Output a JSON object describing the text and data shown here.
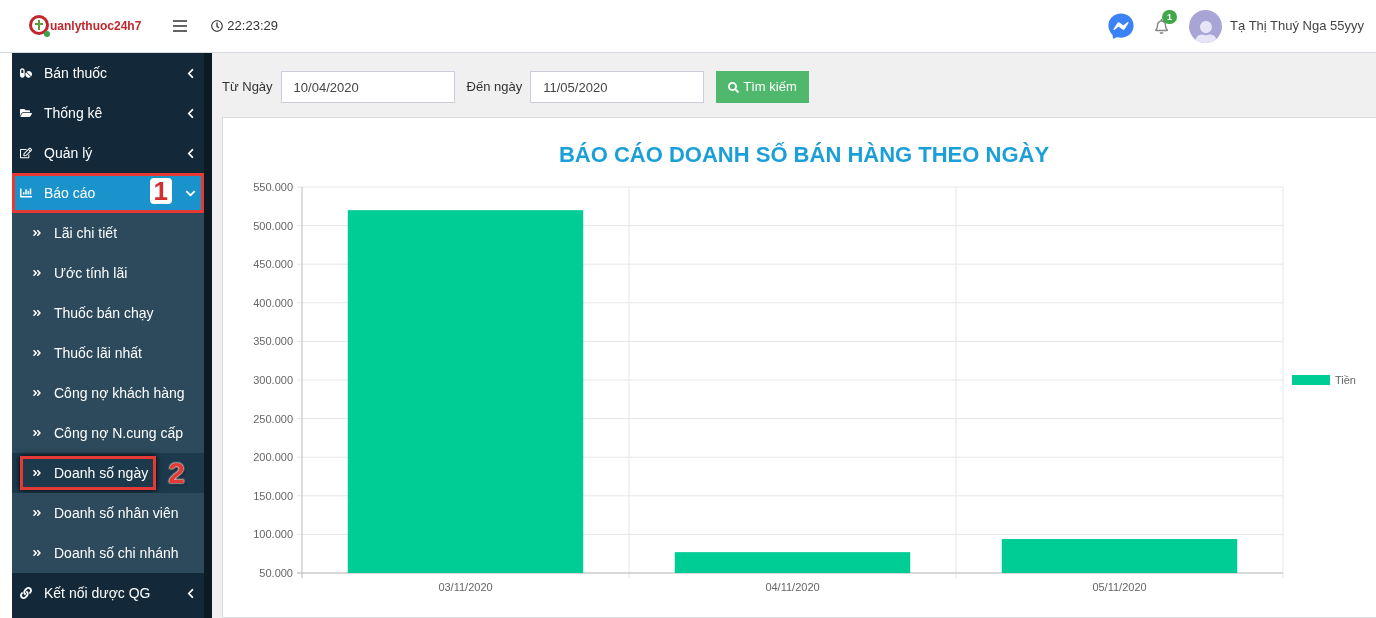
{
  "header": {
    "logo_text": "uanlythuoc24h7",
    "clock": "22:23:29",
    "notifications": "1",
    "user_name": "Tạ Thị Thuý Nga 55yyy"
  },
  "sidebar": {
    "items": [
      {
        "label": "Bán thuốc",
        "expanded": false,
        "highlighted": false
      },
      {
        "label": "Thống kê",
        "expanded": false,
        "highlighted": false
      },
      {
        "label": "Quản lý",
        "expanded": false,
        "highlighted": false
      },
      {
        "label": "Báo cáo",
        "expanded": true,
        "highlighted": true,
        "callout": "1",
        "children": [
          {
            "label": "Lãi chi tiết",
            "selected": false,
            "highlighted": false
          },
          {
            "label": "Ước tính lãi",
            "selected": false,
            "highlighted": false
          },
          {
            "label": "Thuốc bán chạy",
            "selected": false,
            "highlighted": false
          },
          {
            "label": "Thuốc lãi nhất",
            "selected": false,
            "highlighted": false
          },
          {
            "label": "Công nợ khách hàng",
            "selected": false,
            "highlighted": false
          },
          {
            "label": "Công nợ N.cung cấp",
            "selected": false,
            "highlighted": false
          },
          {
            "label": "Doanh số ngày",
            "selected": true,
            "highlighted": true,
            "callout": "2"
          },
          {
            "label": "Doanh số nhân viên",
            "selected": false,
            "highlighted": false
          },
          {
            "label": "Doanh số chi nhánh",
            "selected": false,
            "highlighted": false
          }
        ]
      },
      {
        "label": "Kết nối dược QG",
        "expanded": false,
        "highlighted": false
      }
    ]
  },
  "filter": {
    "from_label": "Từ Ngày",
    "from_value": "10/04/2020",
    "to_label": "Đến ngày",
    "to_value": "11/05/2020",
    "search_button": "Tìm kiếm"
  },
  "report": {
    "chart_data": {
      "type": "bar",
      "title": "BÁO CÁO DOANH SỐ BÁN HÀNG THEO NGÀY",
      "categories": [
        "03/11/2020",
        "04/11/2020",
        "05/11/2020"
      ],
      "series": [
        {
          "name": "Tiền",
          "color": "#00cc96",
          "values": [
            520000,
            77000,
            94000
          ]
        }
      ],
      "ylim": [
        50000,
        550000
      ],
      "grid": true,
      "yticks": [
        {
          "value": 50000,
          "label": "50.000"
        },
        {
          "value": 100000,
          "label": "100.000"
        },
        {
          "value": 150000,
          "label": "150.000"
        },
        {
          "value": 200000,
          "label": "200.000"
        },
        {
          "value": 250000,
          "label": "250.000"
        },
        {
          "value": 300000,
          "label": "300.000"
        },
        {
          "value": 350000,
          "label": "350.000"
        },
        {
          "value": 400000,
          "label": "400.000"
        },
        {
          "value": 450000,
          "label": "450.000"
        },
        {
          "value": 500000,
          "label": "500.000"
        },
        {
          "value": 550000,
          "label": "550.000"
        }
      ]
    }
  }
}
